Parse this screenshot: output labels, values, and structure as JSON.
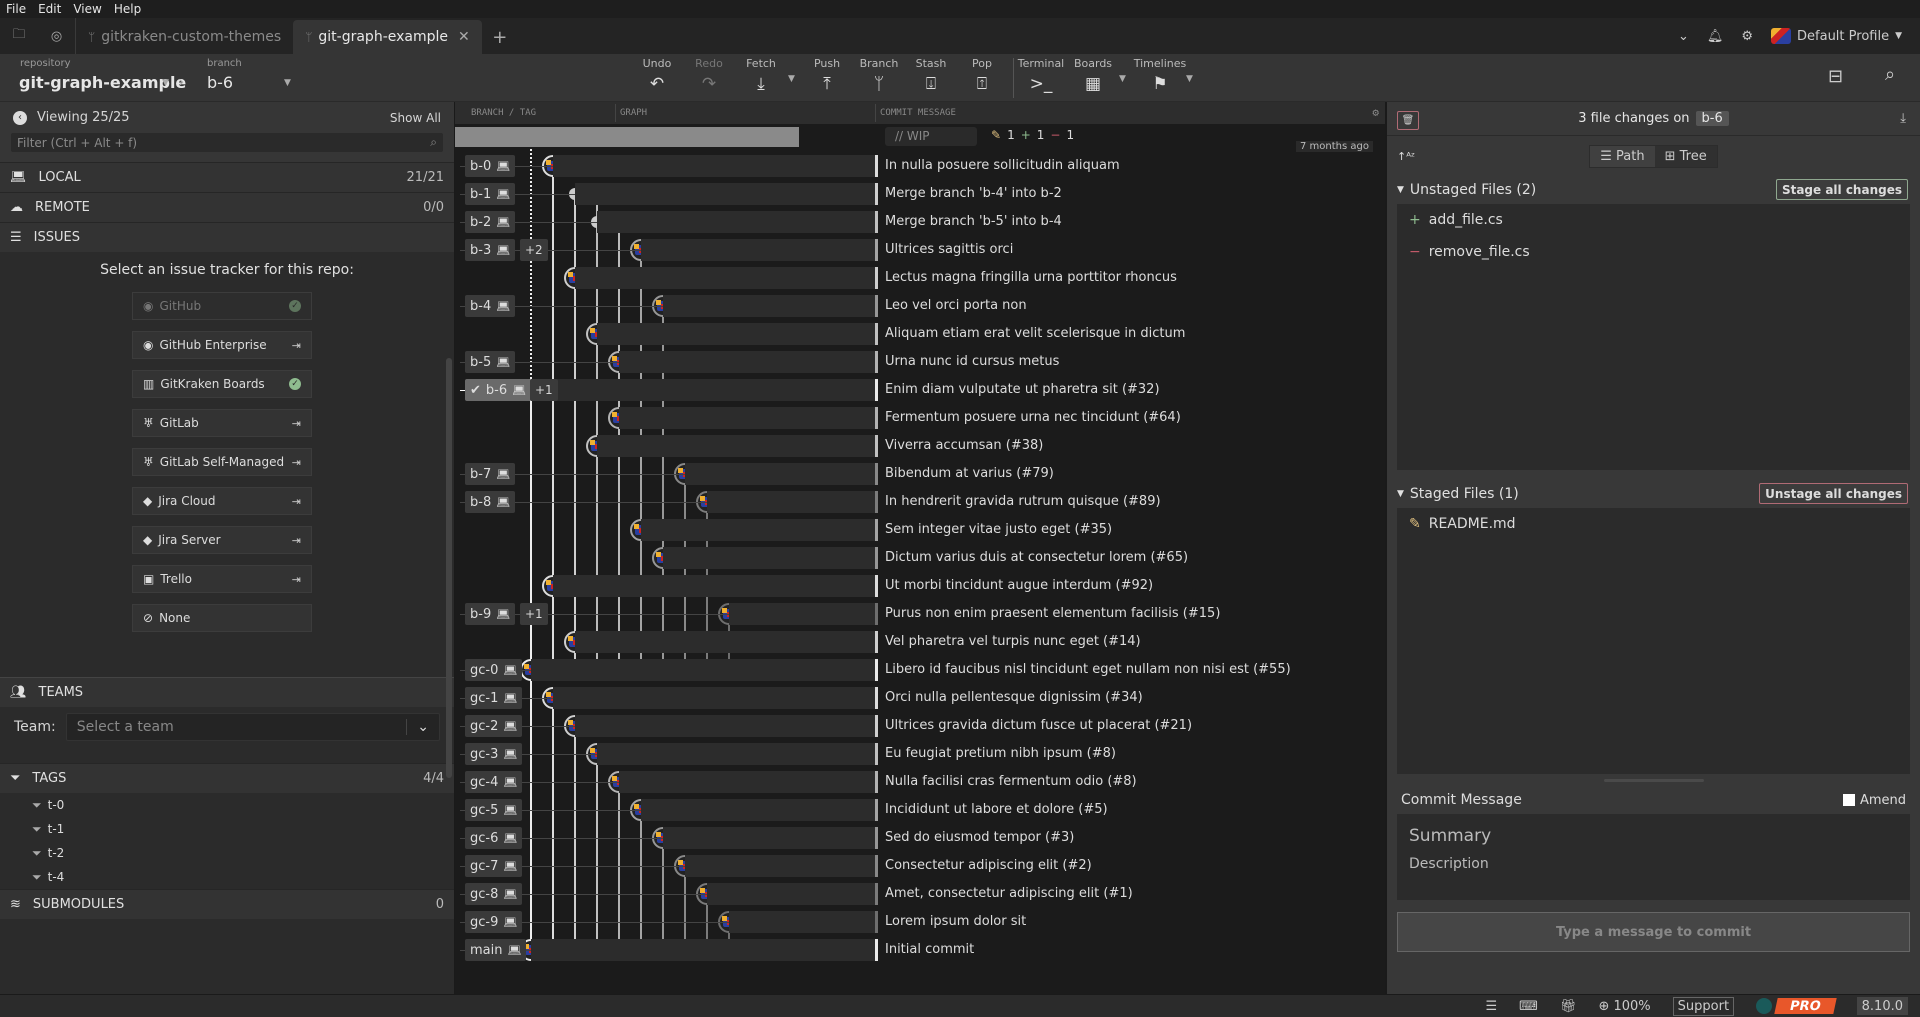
{
  "menu": [
    "File",
    "Edit",
    "View",
    "Help"
  ],
  "tabs": [
    {
      "label": "gitkraken-custom-themes",
      "active": false
    },
    {
      "label": "git-graph-example",
      "active": true
    }
  ],
  "profile": {
    "label": "Default Profile"
  },
  "toolbar": {
    "repository_label": "repository",
    "repository": "git-graph-example",
    "branch_label": "branch",
    "branch": "b-6",
    "buttons": [
      {
        "label": "Undo",
        "icon": "undo-icon",
        "glyph": "↶"
      },
      {
        "label": "Redo",
        "icon": "redo-icon",
        "glyph": "↷",
        "disabled": true
      },
      {
        "label": "Fetch",
        "icon": "fetch-icon",
        "glyph": "⤓"
      },
      {
        "label": "Push",
        "icon": "push-icon",
        "glyph": "⤒"
      },
      {
        "label": "Branch",
        "icon": "branch-icon",
        "glyph": "ᛘ"
      },
      {
        "label": "Stash",
        "icon": "stash-icon",
        "glyph": "⍗"
      },
      {
        "label": "Pop",
        "icon": "pop-icon",
        "glyph": "⍐"
      },
      {
        "label": "Terminal",
        "icon": "terminal-icon",
        "glyph": ">_"
      },
      {
        "label": "Boards",
        "icon": "boards-icon",
        "glyph": "▦"
      },
      {
        "label": "Timelines",
        "icon": "timelines-icon",
        "glyph": "⚑"
      }
    ]
  },
  "sidebar": {
    "viewing": "Viewing 25/25",
    "show_all": "Show All",
    "filter_placeholder": "Filter (Ctrl + Alt + f)",
    "local": {
      "label": "LOCAL",
      "count": "21/21"
    },
    "remote": {
      "label": "REMOTE",
      "count": "0/0"
    },
    "issues": {
      "label": "ISSUES",
      "title": "Select an issue tracker for this repo:",
      "trackers": [
        {
          "label": "GitHub",
          "action": "check",
          "dim": true
        },
        {
          "label": "GitHub Enterprise",
          "action": "login"
        },
        {
          "label": "GitKraken Boards",
          "action": "check"
        },
        {
          "label": "GitLab",
          "action": "login"
        },
        {
          "label": "GitLab Self-Managed",
          "action": "login"
        },
        {
          "label": "Jira Cloud",
          "action": "login"
        },
        {
          "label": "Jira Server",
          "action": "login"
        },
        {
          "label": "Trello",
          "action": "login"
        },
        {
          "label": "None",
          "action": ""
        }
      ]
    },
    "teams": {
      "label": "TEAMS",
      "team_label": "Team:",
      "placeholder": "Select a team"
    },
    "tags": {
      "label": "TAGS",
      "count": "4/4",
      "items": [
        "t-0",
        "t-1",
        "t-2",
        "t-4"
      ]
    },
    "submodules": {
      "label": "SUBMODULES",
      "count": "0"
    }
  },
  "graph": {
    "headers": {
      "branch": "BRANCH / TAG",
      "graph": "GRAPH",
      "message": "COMMIT MESSAGE"
    },
    "wip": {
      "placeholder": "// WIP",
      "modified": "1",
      "added": "1",
      "removed": "1"
    },
    "timestamp": "7 months ago",
    "rows": [
      {
        "branch": "b-0",
        "lane": 1,
        "msg": "In nulla posuere sollicitudin aliquam"
      },
      {
        "branch": "b-1",
        "lane": 2,
        "merge": true,
        "msg": "Merge branch 'b-4' into b-2"
      },
      {
        "branch": "b-2",
        "lane": 3,
        "merge": true,
        "msg": "Merge branch 'b-5' into b-4"
      },
      {
        "branch": "b-3",
        "extra": "+2",
        "lane": 5,
        "msg": "Ultrices sagittis orci"
      },
      {
        "branch": "",
        "lane": 2,
        "msg": "Lectus magna fringilla urna porttitor rhoncus"
      },
      {
        "branch": "b-4",
        "lane": 6,
        "msg": "Leo vel orci porta non"
      },
      {
        "branch": "",
        "lane": 3,
        "msg": "Aliquam etiam erat velit scelerisque in dictum"
      },
      {
        "branch": "b-5",
        "lane": 4,
        "msg": "Urna nunc id cursus metus"
      },
      {
        "branch": "b-6",
        "extra": "+1",
        "lane": 0,
        "current": true,
        "msg": "Enim diam vulputate ut pharetra sit (#32)"
      },
      {
        "branch": "",
        "lane": 4,
        "msg": "Fermentum posuere urna nec tincidunt (#64)"
      },
      {
        "branch": "",
        "lane": 3,
        "msg": "Viverra accumsan (#38)"
      },
      {
        "branch": "b-7",
        "lane": 7,
        "msg": "Bibendum at varius (#79)"
      },
      {
        "branch": "b-8",
        "lane": 8,
        "msg": "In hendrerit gravida rutrum quisque (#89)"
      },
      {
        "branch": "",
        "lane": 5,
        "msg": "Sem integer vitae justo eget (#35)"
      },
      {
        "branch": "",
        "lane": 6,
        "msg": "Dictum varius duis at consectetur lorem (#65)"
      },
      {
        "branch": "",
        "lane": 1,
        "msg": "Ut morbi tincidunt augue interdum (#92)"
      },
      {
        "branch": "b-9",
        "extra": "+1",
        "lane": 9,
        "msg": "Purus non enim praesent elementum facilisis (#15)"
      },
      {
        "branch": "",
        "lane": 2,
        "msg": "Vel pharetra vel turpis nunc eget (#14)"
      },
      {
        "branch": "gc-0",
        "lane": 0,
        "msg": "Libero id faucibus nisl tincidunt eget nullam non nisi est (#55)"
      },
      {
        "branch": "gc-1",
        "lane": 1,
        "msg": "Orci nulla pellentesque dignissim (#34)"
      },
      {
        "branch": "gc-2",
        "lane": 2,
        "msg": "Ultrices gravida dictum fusce ut placerat (#21)"
      },
      {
        "branch": "gc-3",
        "lane": 3,
        "msg": "Eu feugiat pretium nibh ipsum (#8)"
      },
      {
        "branch": "gc-4",
        "lane": 4,
        "msg": "Nulla facilisi cras fermentum odio (#8)"
      },
      {
        "branch": "gc-5",
        "lane": 5,
        "msg": "Incididunt ut labore et dolore (#5)"
      },
      {
        "branch": "gc-6",
        "lane": 6,
        "msg": "Sed do eiusmod tempor (#3)"
      },
      {
        "branch": "gc-7",
        "lane": 7,
        "msg": "Consectetur adipiscing elit (#2)"
      },
      {
        "branch": "gc-8",
        "lane": 8,
        "msg": "Amet, consectetur adipiscing elit (#1)"
      },
      {
        "branch": "gc-9",
        "lane": 9,
        "msg": "Lorem ipsum dolor sit"
      },
      {
        "branch": "main",
        "lane": 0,
        "msg": "Initial commit"
      }
    ]
  },
  "right": {
    "title": "3 file changes on",
    "branch": "b-6",
    "view_path": "Path",
    "view_tree": "Tree",
    "unstaged": {
      "label": "Unstaged Files (2)",
      "button": "Stage all changes",
      "files": [
        {
          "name": "add_file.cs",
          "type": "added"
        },
        {
          "name": "remove_file.cs",
          "type": "removed"
        }
      ]
    },
    "staged": {
      "label": "Staged Files (1)",
      "button": "Unstage all changes",
      "files": [
        {
          "name": "README.md",
          "type": "modified"
        }
      ]
    },
    "commit": {
      "label": "Commit Message",
      "amend": "Amend",
      "summary": "Summary",
      "description": "Description",
      "button": "Type a message to commit"
    }
  },
  "status": {
    "zoom": "100%",
    "support": "Support",
    "pro": "PRO",
    "version": "8.10.0"
  },
  "colors": {
    "accent_green": "#8fbc8f",
    "accent_red": "#c45a6a",
    "pro": "#e8572a"
  }
}
